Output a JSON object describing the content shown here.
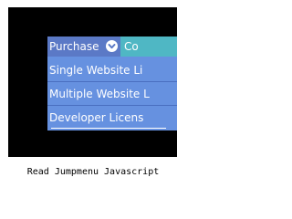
{
  "menu": {
    "top_items": [
      {
        "label": "Purchase",
        "icon": "chevron-down-circle-icon"
      },
      {
        "label": "Co"
      }
    ],
    "sub_items": [
      {
        "label": "Single Website Li"
      },
      {
        "label": "Multiple Website L"
      },
      {
        "label": "Developer Licens"
      }
    ]
  },
  "caption": "Read Jumpmenu Javascript",
  "colors": {
    "stage": "#000000",
    "top_active": "#5b79c6",
    "top_next": "#4fb7c4",
    "submenu": "#6691e0",
    "text": "#ffffff"
  }
}
